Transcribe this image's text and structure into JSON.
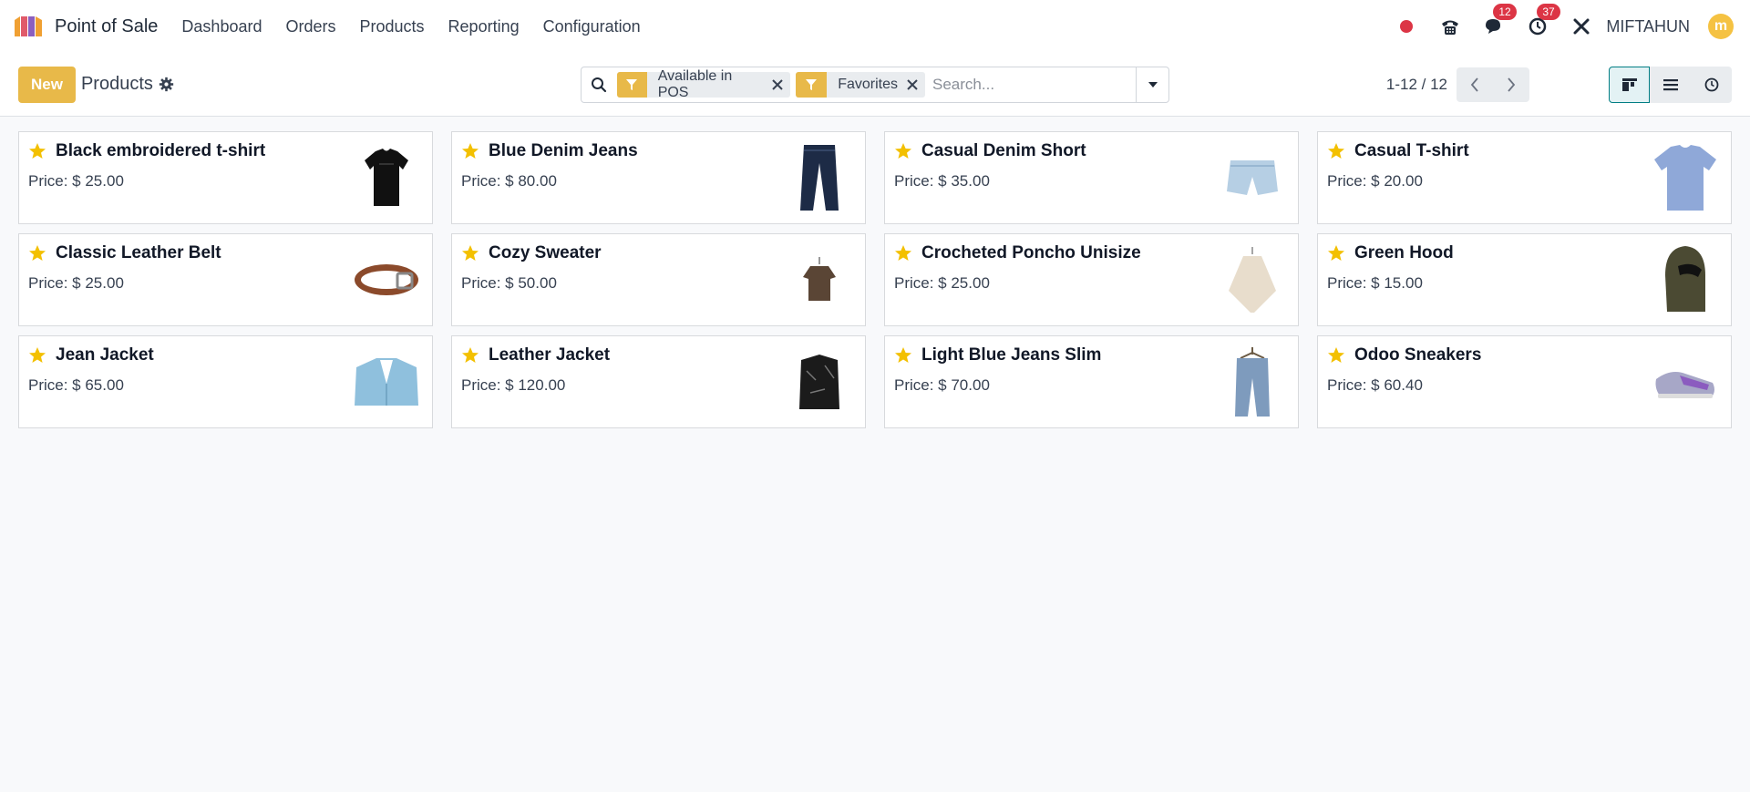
{
  "navbar": {
    "app_name": "Point of Sale",
    "menu": [
      "Dashboard",
      "Orders",
      "Products",
      "Reporting",
      "Configuration"
    ],
    "messages_count": "12",
    "activities_count": "37",
    "user_name": "MIFTAHUN",
    "avatar_letter": "m"
  },
  "control": {
    "new_label": "New",
    "title": "Products",
    "facets": [
      "Available in POS",
      "Favorites"
    ],
    "search_placeholder": "Search...",
    "pager": "1-12 / 12"
  },
  "colors": {
    "accent": "#e8b949",
    "active_view": "#017e84",
    "badge": "#dc3545",
    "star": "#f3c000"
  },
  "products": [
    {
      "name": "Black embroidered t-shirt",
      "price": "Price: $ 25.00",
      "icon": "black-tshirt-image"
    },
    {
      "name": "Blue Denim Jeans",
      "price": "Price: $ 80.00",
      "icon": "jeans-image"
    },
    {
      "name": "Casual Denim Short",
      "price": "Price: $ 35.00",
      "icon": "denim-short-image"
    },
    {
      "name": "Casual T-shirt",
      "price": "Price: $ 20.00",
      "icon": "blue-tshirt-image"
    },
    {
      "name": "Classic Leather Belt",
      "price": "Price: $ 25.00",
      "icon": "belt-image"
    },
    {
      "name": "Cozy Sweater",
      "price": "Price: $ 50.00",
      "icon": "sweater-image"
    },
    {
      "name": "Crocheted Poncho Unisize",
      "price": "Price: $ 25.00",
      "icon": "poncho-image"
    },
    {
      "name": "Green Hood",
      "price": "Price: $ 15.00",
      "icon": "hood-image"
    },
    {
      "name": "Jean Jacket",
      "price": "Price: $ 65.00",
      "icon": "jean-jacket-image"
    },
    {
      "name": "Leather Jacket",
      "price": "Price: $ 120.00",
      "icon": "leather-jacket-image"
    },
    {
      "name": "Light Blue Jeans Slim",
      "price": "Price: $ 70.00",
      "icon": "light-jeans-image"
    },
    {
      "name": "Odoo Sneakers",
      "price": "Price: $ 60.40",
      "icon": "sneakers-image"
    }
  ]
}
